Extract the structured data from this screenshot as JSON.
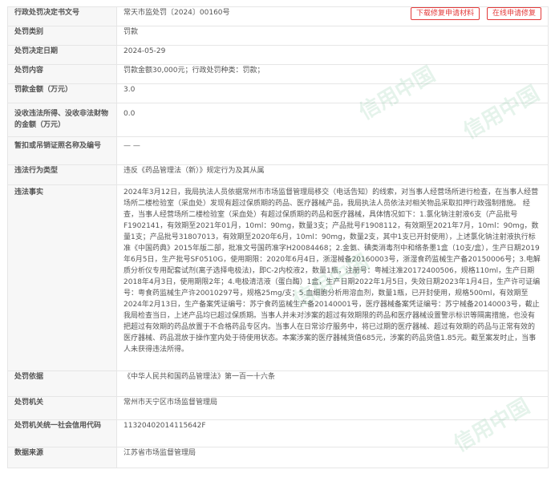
{
  "record": {
    "doc_no_label": "行政处罚决定书文号",
    "doc_no_value": "常天市监处罚〔2024〕00160号",
    "btn_download": "下载修复申请材料",
    "btn_online": "在线申请修复",
    "type_label": "处罚类别",
    "type_value": "罚款",
    "date_label": "处罚决定日期",
    "date_value": "2024-05-29",
    "content_label": "处罚内容",
    "content_value": "罚款金额30,000元；行政处罚种类：罚款；",
    "amount_label": "罚款金额（万元）",
    "amount_value": "3.0",
    "confiscated_label": "没收违法所得、没收非法财物的金额（万元）",
    "confiscated_value": "0.0",
    "revoke_label": "暂扣或吊销证照名称及编号",
    "revoke_value": "— —",
    "violation_type_label": "违法行为类型",
    "violation_type_value": "违反《药品管理法（新）》规定行为及其从属",
    "facts_label": "违法事实",
    "facts_value": "2024年3月12日，我局执法人员依据常州市市场监督管理局移交（电话告知）的线索，对当事人经营场所进行检查，在当事人经营场所二楼检验室（采血处）发现有超过保质期的药品、医疗器械产品，我局执法人员依法对相关物品采取扣押行政强制措施。 经查，当事人经营场所二楼检验室（采血处）有超过保质期的药品和医疗器械，具体情况如下：1.氯化钠注射液6支（产品批号F1902141，有效期至2021年01月，10ml：90mg，数量3支；产品批号F1908112，有效期至2021年7月，10ml：90mg，数量1支；产品批号31807013，有效期至2020年6月，10ml：90mg，数量2支，其中1支已开封使用），上述氯化钠注射液执行标准《中国药典》2015年版二部，批准文号国药准字H20084468；2.金氨、碘类消毒剂中和络条墨1盒（10支/盒），生产日期2019年6月5日，生产批号SF0510G，使用期限：2020年6月4日，浙湿械备20160003号，浙湿食药监械生产备20150006号；3.电解质分析仪专用配套试剂(离子选择电极法)，即C-2内校液2，数量1瓶，注册号：粤械注准20172400506，规格110ml，生产日期2018年4月3日，使用期限2年；4.电极清洁液（蛋白酶）1盒，生产日期2022年1月5日，失效日期2023年1月4日，生产许可证编号：粤食药监械生产许20010297号，规格25mg/支；5.血细胞分析用溶血剂，数量1瓶，已开封使用，规格500ml，有效期至2024年2月13日，生产备案凭证编号：苏宁食药监械生产备20140001号，医疗器械备案凭证编号：苏宁械备20140003号，截止我局检查当日，上述产品均已超过保质期。当事人并未对涉案的超过有效期限的药品和医疗器械设置警示标识等隔离措施，也没有把超过有效期的药品放置于不合格药品专区内。当事人在日常诊疗服务中，将已过期的医疗器械、超过有效期的药品与正常有效的医疗器械、药品混放于操作室内处于待使用状态。本案涉案的医疗器械货值685元，涉案的药品货值1.85元。截至案发时止，当事人未获得违法所得。",
    "basis_label": "处罚依据",
    "basis_value": "《中华人民共和国药品管理法》第一百一十六条",
    "authority_label": "处罚机关",
    "authority_value": "常州市天宁区市场监督管理局",
    "credit_code_label": "处罚机关统一社会信用代码",
    "credit_code_value": "11320402014115642F",
    "source_label": "数据来源",
    "source_value": "江苏省市场监督管理局"
  },
  "watermark": {
    "text": "信用中国"
  }
}
